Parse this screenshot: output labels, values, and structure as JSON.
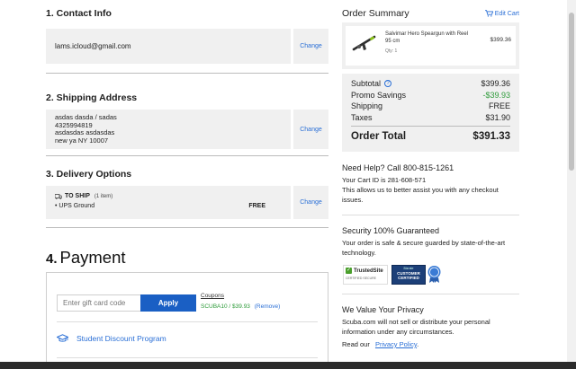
{
  "contact": {
    "title": "1. Contact Info",
    "email": "lams.icloud@gmail.com",
    "change_label": "Change"
  },
  "shipping": {
    "title": "2. Shipping Address",
    "lines": [
      "asdas dasda / sadas",
      "4325994819",
      "asdasdas asdasdas",
      "new ya NY 10007"
    ],
    "change_label": "Change"
  },
  "delivery": {
    "title": "3. Delivery Options",
    "to_ship_label": "TO SHIP",
    "item_count": "(1 item)",
    "method": "UPS Ground",
    "price": "FREE",
    "change_label": "Change"
  },
  "payment": {
    "title_number": "4.",
    "title_text": "Payment",
    "gift_placeholder": "Enter gift card code",
    "apply_label": "Apply",
    "coupons_label": "Coupons",
    "coupon_code": "SCUBA10 / $39.93",
    "remove_label": "(Remove)",
    "student_link": "Student Discount Program"
  },
  "summary": {
    "title": "Order Summary",
    "edit_cart": "Edit Cart",
    "product_name": "Salvimar Hero Speargun with Reel 95 cm",
    "qty": "Qty: 1",
    "product_price": "$399.36",
    "rows": [
      {
        "label": "Subtotal",
        "value": "$399.36"
      },
      {
        "label": "Promo Savings",
        "value": "-$39.93"
      },
      {
        "label": "Shipping",
        "value": "FREE"
      },
      {
        "label": "Taxes",
        "value": "$31.90"
      }
    ],
    "total_label": "Order Total",
    "total_value": "$391.33"
  },
  "help": {
    "title": "Need Help? Call 800-815-1261",
    "cart_id": "Your Cart ID is 281-608-571",
    "desc": "This allows us to better assist you with any checkout issues."
  },
  "security": {
    "title": "Security 100% Guaranteed",
    "desc": "Your order is safe & secure guarded by state-of-the-art technology.",
    "trustedsite_label": "TrustedSite",
    "trustedsite_sub": "CERTIFIED SECURE",
    "bizrate_top": "Bizrate",
    "bizrate_mid": "CUSTOMER CERTIFIED"
  },
  "privacy": {
    "title": "We Value Your Privacy",
    "desc": "Scuba.com will not sell or distribute your personal information under any circumstances.",
    "read_our": "Read our",
    "policy_link": "Privacy Policy",
    "period": "."
  },
  "colors": {
    "link": "#2a6fd6",
    "apply": "#1a5fc4",
    "promo": "#2e9b3a"
  }
}
